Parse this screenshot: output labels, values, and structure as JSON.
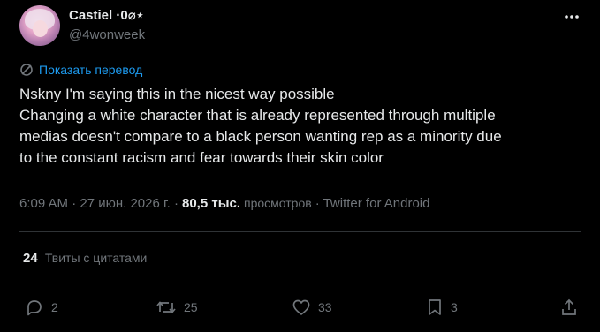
{
  "author": {
    "display_name": "Castiel ·0⌀⋆",
    "handle": "@4wonweek"
  },
  "translate": {
    "label": "Показать перевод"
  },
  "tweet": {
    "lines": [
      "Nskny I'm saying this in the nicest way possible",
      "Changing a white character that is already represented through multiple",
      "medias doesn't compare to a black person wanting rep as a minority due",
      "to the constant racism and fear towards their skin color"
    ]
  },
  "meta": {
    "time_date": "6:09 AM · 27 июн. 2026 г. ·",
    "views_count": "80,5 тыс.",
    "views_word": "просмотров",
    "source": "· Twitter for Android"
  },
  "quotes": {
    "count": "24",
    "label": "Твиты с цитатами"
  },
  "actions": {
    "replies": "2",
    "retweets": "25",
    "likes": "33",
    "bookmarks": "3"
  },
  "colors": {
    "background": "#000000",
    "text": "#e7e9ea",
    "secondary": "#71767b",
    "accent": "#1d9bf0",
    "divider": "#2f3336"
  },
  "icons": [
    "more-icon",
    "translate-icon",
    "reply-icon",
    "retweet-icon",
    "like-icon",
    "bookmark-icon",
    "share-icon"
  ]
}
